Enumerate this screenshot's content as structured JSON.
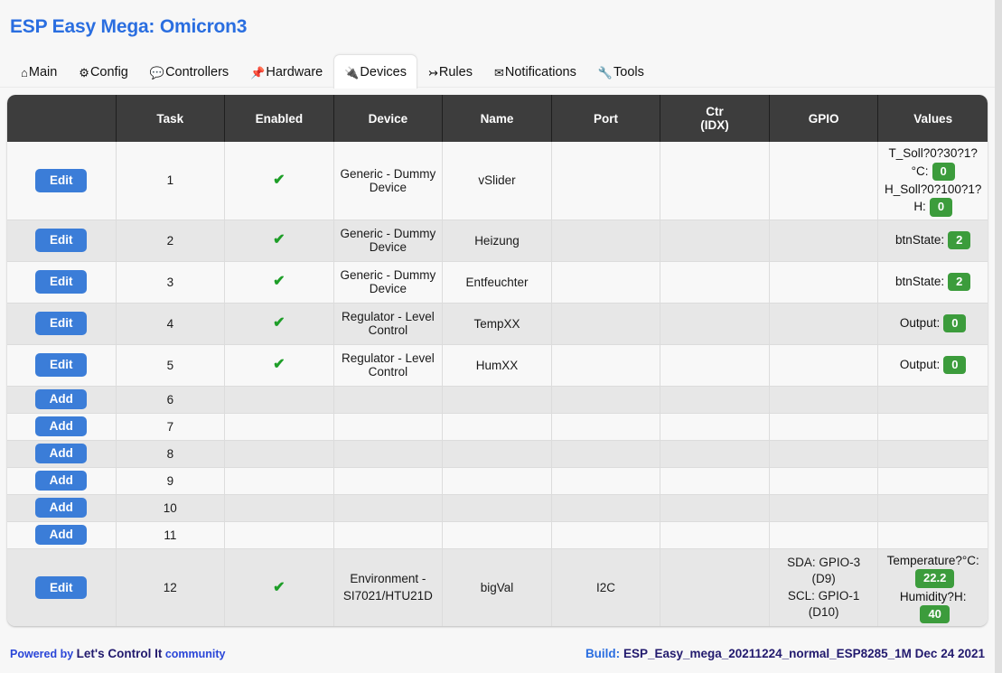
{
  "header": {
    "title": "ESP Easy Mega: Omicron3"
  },
  "tabs": [
    {
      "label": "Main",
      "icon": "home-icon",
      "glyph": "⌂",
      "active": false
    },
    {
      "label": "Config",
      "icon": "gear-icon",
      "glyph": "⚙",
      "active": false
    },
    {
      "label": "Controllers",
      "icon": "speech-bubble-icon",
      "glyph": "💬",
      "active": false
    },
    {
      "label": "Hardware",
      "icon": "pin-icon",
      "glyph": "📌",
      "active": false
    },
    {
      "label": "Devices",
      "icon": "plug-icon",
      "glyph": "🔌",
      "active": true
    },
    {
      "label": "Rules",
      "icon": "arrow-branch-icon",
      "glyph": "↣",
      "active": false
    },
    {
      "label": "Notifications",
      "icon": "envelope-icon",
      "glyph": "✉",
      "active": false
    },
    {
      "label": "Tools",
      "icon": "wrench-icon",
      "glyph": "🔧",
      "active": false
    }
  ],
  "table": {
    "columns": [
      {
        "key": "action",
        "label": ""
      },
      {
        "key": "task",
        "label": "Task"
      },
      {
        "key": "enabled",
        "label": "Enabled"
      },
      {
        "key": "device",
        "label": "Device"
      },
      {
        "key": "name",
        "label": "Name"
      },
      {
        "key": "port",
        "label": "Port"
      },
      {
        "key": "ctr",
        "label": "Ctr (IDX)",
        "line1": "Ctr",
        "line2": "(IDX)"
      },
      {
        "key": "gpio",
        "label": "GPIO"
      },
      {
        "key": "values",
        "label": "Values"
      }
    ],
    "rows": [
      {
        "action": "Edit",
        "task": "1",
        "enabled": "✔",
        "device": "Generic - Dummy Device",
        "name": "vSlider",
        "port": "",
        "ctr": "",
        "gpio": "",
        "values": [
          {
            "label": "T_Soll?0?30?1?°C:",
            "value": "0"
          },
          {
            "label": "H_Soll?0?100?1?H:",
            "value": "0"
          }
        ]
      },
      {
        "action": "Edit",
        "task": "2",
        "enabled": "✔",
        "device": "Generic - Dummy Device",
        "name": "Heizung",
        "port": "",
        "ctr": "",
        "gpio": "",
        "values": [
          {
            "label": "btnState:",
            "value": "2"
          }
        ]
      },
      {
        "action": "Edit",
        "task": "3",
        "enabled": "✔",
        "device": "Generic - Dummy Device",
        "name": "Entfeuchter",
        "port": "",
        "ctr": "",
        "gpio": "",
        "values": [
          {
            "label": "btnState:",
            "value": "2"
          }
        ]
      },
      {
        "action": "Edit",
        "task": "4",
        "enabled": "✔",
        "device": "Regulator - Level Control",
        "name": "TempXX",
        "port": "",
        "ctr": "",
        "gpio": "",
        "values": [
          {
            "label": "Output:",
            "value": "0"
          }
        ]
      },
      {
        "action": "Edit",
        "task": "5",
        "enabled": "✔",
        "device": "Regulator - Level Control",
        "name": "HumXX",
        "port": "",
        "ctr": "",
        "gpio": "",
        "values": [
          {
            "label": "Output:",
            "value": "0"
          }
        ]
      },
      {
        "action": "Add",
        "task": "6",
        "enabled": "",
        "device": "",
        "name": "",
        "port": "",
        "ctr": "",
        "gpio": "",
        "values": []
      },
      {
        "action": "Add",
        "task": "7",
        "enabled": "",
        "device": "",
        "name": "",
        "port": "",
        "ctr": "",
        "gpio": "",
        "values": []
      },
      {
        "action": "Add",
        "task": "8",
        "enabled": "",
        "device": "",
        "name": "",
        "port": "",
        "ctr": "",
        "gpio": "",
        "values": []
      },
      {
        "action": "Add",
        "task": "9",
        "enabled": "",
        "device": "",
        "name": "",
        "port": "",
        "ctr": "",
        "gpio": "",
        "values": []
      },
      {
        "action": "Add",
        "task": "10",
        "enabled": "",
        "device": "",
        "name": "",
        "port": "",
        "ctr": "",
        "gpio": "",
        "values": []
      },
      {
        "action": "Add",
        "task": "11",
        "enabled": "",
        "device": "",
        "name": "",
        "port": "",
        "ctr": "",
        "gpio": "",
        "values": []
      },
      {
        "action": "Edit",
        "task": "12",
        "enabled": "✔",
        "device": "Environment - SI7021/HTU21D",
        "device_line1": "Environment -",
        "device_line2": "SI7021/HTU21D",
        "name": "bigVal",
        "port": "I2C",
        "ctr": "",
        "gpio": "SDA: GPIO-3 (D9) SCL: GPIO-1 (D10)",
        "gpio_line1": "SDA: GPIO-3 (D9)",
        "gpio_line2": "SCL: GPIO-1 (D10)",
        "values": [
          {
            "label": "Temperature?°C:",
            "value": "22.2"
          },
          {
            "label": "Humidity?H:",
            "value": "40"
          }
        ]
      }
    ]
  },
  "footer": {
    "powered_by": "Powered by ",
    "brand": "Let's Control It",
    "community": " community",
    "build_label": "Build: ",
    "build_value": "ESP_Easy_mega_20211224_normal_ESP8285_1M Dec 24 2021"
  },
  "colors": {
    "accent_blue": "#2a6ee0",
    "button_blue": "#3b7dd8",
    "badge_green": "#3c9c3c",
    "check_green": "#1e9e28",
    "header_dark": "#3d3d3d",
    "row_odd": "#f8f8f8",
    "row_even": "#e7e7e7"
  }
}
